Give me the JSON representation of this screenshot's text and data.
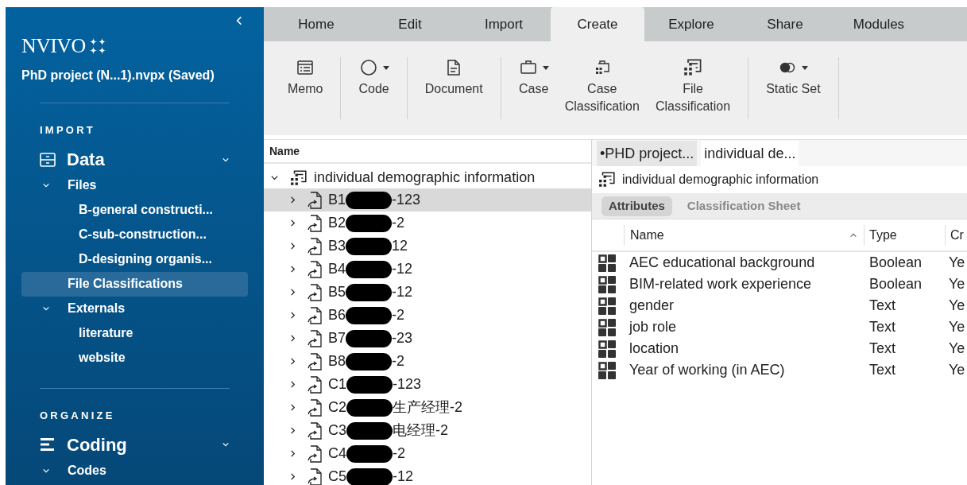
{
  "sidebar": {
    "logo": "NVIVO",
    "project": "PhD project (N...1).nvpx (Saved)",
    "sections": [
      {
        "heading": "IMPORT",
        "group": {
          "label": "Data",
          "kind": "data",
          "expanded": true
        },
        "items": [
          {
            "label": "Files",
            "expanded": true,
            "selected": false,
            "children": [
              {
                "label": "B-general constructi...",
                "selected": false
              },
              {
                "label": "C-sub-construction...",
                "selected": false
              },
              {
                "label": "D-designing organis...",
                "selected": false
              }
            ]
          },
          {
            "label": "File Classifications",
            "selected": true
          },
          {
            "label": "Externals",
            "expanded": true,
            "selected": false,
            "children": [
              {
                "label": "literature",
                "selected": false
              },
              {
                "label": "website",
                "selected": false
              }
            ]
          }
        ]
      },
      {
        "heading": "ORGANIZE",
        "group": {
          "label": "Coding",
          "kind": "coding",
          "expanded": true
        },
        "items": [
          {
            "label": "Codes",
            "expanded": true,
            "selected": false
          }
        ]
      }
    ]
  },
  "tabs": [
    {
      "label": "Home",
      "selected": false
    },
    {
      "label": "Edit",
      "selected": false
    },
    {
      "label": "Import",
      "selected": false
    },
    {
      "label": "Create",
      "selected": true
    },
    {
      "label": "Explore",
      "selected": false
    },
    {
      "label": "Share",
      "selected": false
    },
    {
      "label": "Modules",
      "selected": false
    }
  ],
  "ribbon": [
    {
      "kind": "memo",
      "label": "Memo",
      "dropdown": false,
      "separator_after": true
    },
    {
      "kind": "code",
      "label": "Code",
      "dropdown": true,
      "separator_after": true
    },
    {
      "kind": "document",
      "label": "Document",
      "dropdown": false,
      "separator_after": true
    },
    {
      "kind": "case",
      "label": "Case",
      "dropdown": true,
      "separator_after": false
    },
    {
      "kind": "case-classification",
      "label": "Case\nClassification",
      "dropdown": false,
      "separator_after": false
    },
    {
      "kind": "file-classification",
      "label": "File\nClassification",
      "dropdown": false,
      "separator_after": true
    },
    {
      "kind": "static-set",
      "label": "Static Set",
      "dropdown": true,
      "separator_after": true
    }
  ],
  "tree": {
    "column": "Name",
    "root": {
      "label": "individual demographic information",
      "expanded": true
    },
    "children": [
      {
        "prefix": "B1",
        "suffix": "-123",
        "selected": true
      },
      {
        "prefix": "B2",
        "suffix": "-2",
        "selected": false
      },
      {
        "prefix": "B3",
        "suffix": "12",
        "selected": false
      },
      {
        "prefix": "B4",
        "suffix": "-12",
        "selected": false
      },
      {
        "prefix": "B5",
        "suffix": "-12",
        "selected": false
      },
      {
        "prefix": "B6",
        "suffix": "-2",
        "selected": false
      },
      {
        "prefix": "B7",
        "suffix": "-23",
        "selected": false
      },
      {
        "prefix": "B8",
        "suffix": "-2",
        "selected": false
      },
      {
        "prefix": "C1",
        "suffix": "-123",
        "selected": false
      },
      {
        "prefix": "C2",
        "suffix": "生产经理-2",
        "selected": false
      },
      {
        "prefix": "C3",
        "suffix": "电经理-2",
        "selected": false
      },
      {
        "prefix": "C4",
        "suffix": "-2",
        "selected": false
      },
      {
        "prefix": "C5",
        "suffix": "-12",
        "selected": false
      }
    ]
  },
  "detail": {
    "doc_tabs": [
      {
        "label": "•PHD project...",
        "selected": false
      },
      {
        "label": "individual de...",
        "selected": true
      }
    ],
    "title": "individual demographic information",
    "view_tabs": [
      {
        "label": "Attributes",
        "selected": true
      },
      {
        "label": "Classification Sheet",
        "selected": false
      }
    ],
    "table": {
      "columns": [
        "Name",
        "Type",
        "Cr"
      ],
      "rows": [
        [
          "AEC educational background",
          "Boolean",
          "Ye"
        ],
        [
          "BIM-related work experience",
          "Boolean",
          "Ye"
        ],
        [
          "gender",
          "Text",
          "Ye"
        ],
        [
          "job role",
          "Text",
          "Ye"
        ],
        [
          "location",
          "Text",
          "Ye"
        ],
        [
          "Year of working (in AEC)",
          "Text",
          "Ye"
        ]
      ]
    }
  }
}
